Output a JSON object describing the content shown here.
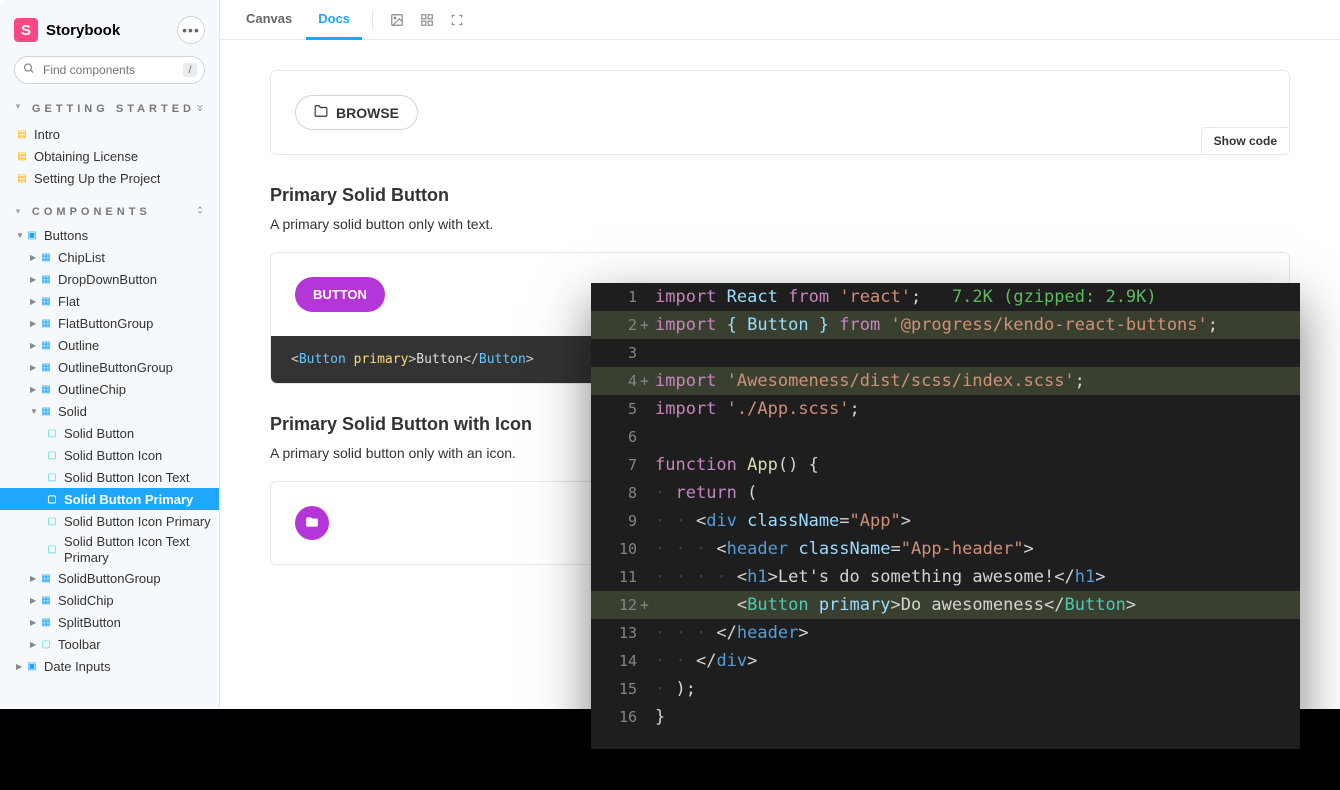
{
  "brand": "Storybook",
  "search": {
    "placeholder": "Find components",
    "slash": "/"
  },
  "sections": {
    "getting_started": {
      "title": "GETTING STARTED",
      "items": [
        "Intro",
        "Obtaining License",
        "Setting Up the Project"
      ]
    },
    "components": {
      "title": "COMPONENTS",
      "buttons": "Buttons",
      "items": [
        "ChipList",
        "DropDownButton",
        "Flat",
        "FlatButtonGroup",
        "Outline",
        "OutlineButtonGroup",
        "OutlineChip"
      ],
      "solid": "Solid",
      "solid_items": [
        "Solid Button",
        "Solid Button Icon",
        "Solid Button Icon Text",
        "Solid Button Primary",
        "Solid Button Icon Primary",
        "Solid Button Icon Text Primary"
      ],
      "after_solid": [
        "SolidButtonGroup",
        "SolidChip",
        "SplitButton",
        "Toolbar"
      ],
      "date_inputs": "Date Inputs"
    }
  },
  "toolbar": {
    "canvas": "Canvas",
    "docs": "Docs"
  },
  "browse": {
    "label": "BROWSE",
    "show_code": "Show code"
  },
  "primary_solid": {
    "title": "Primary Solid Button",
    "desc": "A primary solid button only with text.",
    "btn": "BUTTON",
    "code_tag": "Button",
    "code_attr": "primary",
    "code_text": "Button"
  },
  "primary_icon": {
    "title": "Primary Solid Button with Icon",
    "desc": "A primary solid button only with an icon."
  },
  "editor": {
    "size_hint": "7.2K (gzipped: 2.9K)",
    "import_react": "import",
    "react": "React",
    "from": "from",
    "react_str": "'react'",
    "button_import": "{ Button }",
    "kendo_str": "'@progress/kendo-react-buttons'",
    "awesome_str": "'Awesomeness/dist/scss/index.scss'",
    "app_scss": "'./App.scss'",
    "function": "function",
    "app_fn": "App",
    "return": "return",
    "div": "div",
    "header": "header",
    "h1": "h1",
    "className": "className",
    "app_cls": "\"App\"",
    "header_cls": "\"App-header\"",
    "h1_text": "Let's do something awesome!",
    "btn_text": "Do awesomeness",
    "primary_attr": "primary"
  }
}
